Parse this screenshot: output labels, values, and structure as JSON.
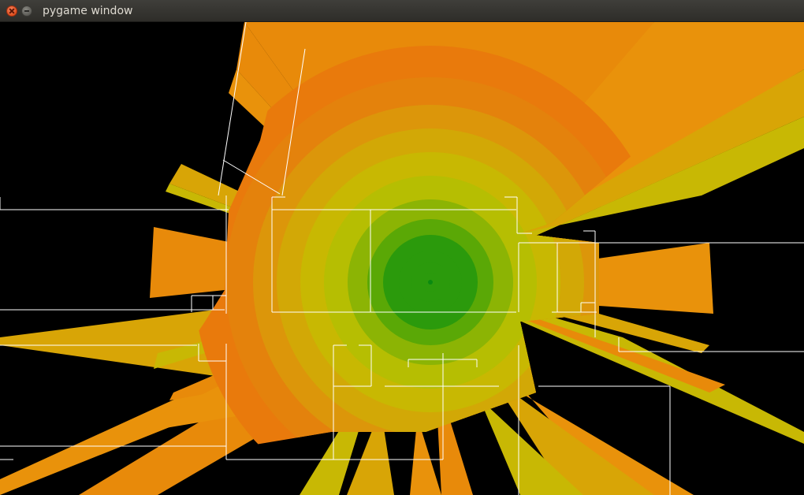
{
  "window": {
    "title": "pygame window"
  },
  "icons": {
    "close": "close-icon",
    "minimize": "minimize-icon"
  },
  "scene": {
    "center_color": "#0a8a10",
    "ring_colors": [
      "#2b9a0c",
      "#5aa806",
      "#8cb404",
      "#b6be02",
      "#c8b802",
      "#d2a806",
      "#dc960a",
      "#e4820c",
      "#e97a0c"
    ],
    "ray_colors": [
      "#e88a0a",
      "#e9920b",
      "#d8a506",
      "#c8b804"
    ],
    "wall_color": "#ffffff",
    "background_color": "#000000"
  }
}
